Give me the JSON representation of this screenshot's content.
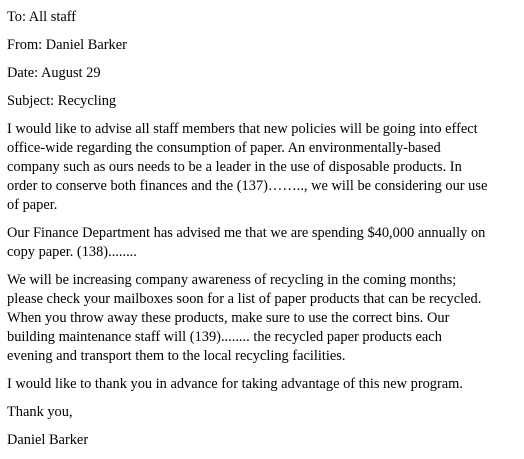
{
  "memo": {
    "to": "To: All staff",
    "from": "From: Daniel Barker",
    "date": "Date: August 29",
    "subject": "Subject: Recycling"
  },
  "paragraphs": [
    {
      "lines": [
        "I would like to advise all staff members that new policies will be going into effect",
        "office-wide regarding the consumption of paper. An environmentally-based",
        "company such as ours needs to be a leader in the use of disposable products. In",
        "order to conserve both finances and the (137)…….., we will be considering our use",
        "of paper."
      ]
    },
    {
      "lines": [
        "Our Finance Department has advised me that we are spending $40,000 annually on",
        "copy paper. (138)........"
      ]
    },
    {
      "lines": [
        "We will be increasing company awareness of recycling in the coming months;",
        "please check your mailboxes soon for a list of paper products that can be recycled.",
        "When you throw away these products, make sure to use the correct bins. Our",
        "building maintenance staff will (139)........ the recycled paper products each",
        "evening and transport them to the local recycling facilities."
      ]
    },
    {
      "lines": [
        "I would like to thank you in advance for taking advantage of this new program."
      ]
    }
  ],
  "closing": "Thank you,",
  "signature": "Daniel Barker"
}
